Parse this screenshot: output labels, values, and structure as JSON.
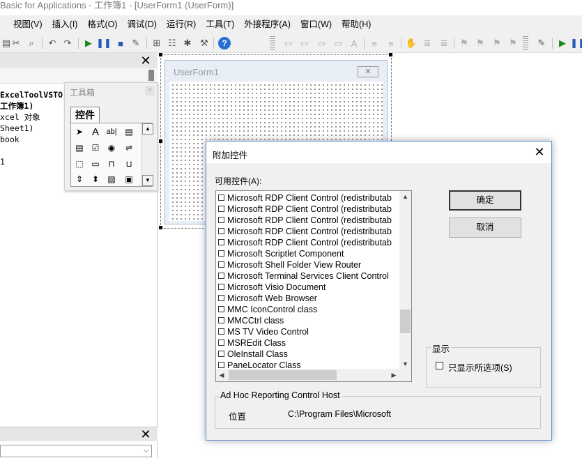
{
  "window": {
    "title": "Basic for Applications - 工作簿1 - [UserForm1 (UserForm)]"
  },
  "menu": [
    "视图(V)",
    "插入(I)",
    "格式(O)",
    "调试(D)",
    "运行(R)",
    "工具(T)",
    "外接程序(A)",
    "窗口(W)",
    "帮助(H)"
  ],
  "project_tree": [
    "ExcelToolVSTO)",
    "工作簿1)",
    "xcel 对象",
    "Sheet1)",
    "book",
    "",
    "1"
  ],
  "toolbox": {
    "title": "工具箱",
    "tab": "控件",
    "tools": [
      "pointer",
      "label",
      "textbox",
      "combobox",
      "listbox",
      "checkbox",
      "optionbutton",
      "togglebutton",
      "frame",
      "commandbutton",
      "tabstrip",
      "multipage",
      "scrollbar",
      "spinbutton",
      "image",
      "refedit"
    ]
  },
  "userform": {
    "title": "UserForm1"
  },
  "dialog": {
    "title": "附加控件",
    "available_label": "可用控件(A):",
    "items": [
      "Microsoft RDP Client Control (redistributab",
      "Microsoft RDP Client Control (redistributab",
      "Microsoft RDP Client Control (redistributab",
      "Microsoft RDP Client Control (redistributab",
      "Microsoft RDP Client Control (redistributab",
      "Microsoft Scriptlet Component",
      "Microsoft Shell Folder View Router",
      "Microsoft Terminal Services Client Control",
      "Microsoft Visio Document",
      "Microsoft Web Browser",
      "MMC IconControl class",
      "MMCCtrl class",
      "MS TV Video Control",
      "MSREdit Class",
      "OleInstall Class",
      "PaneLocator Class"
    ],
    "ok": "确定",
    "cancel": "取消",
    "show_group": "显示",
    "show_selected": "只显示所选项(S)",
    "selected_control": "Ad Hoc Reporting Control Host",
    "location_label": "位置",
    "location_value": "C:\\Program Files\\Microsoft"
  }
}
